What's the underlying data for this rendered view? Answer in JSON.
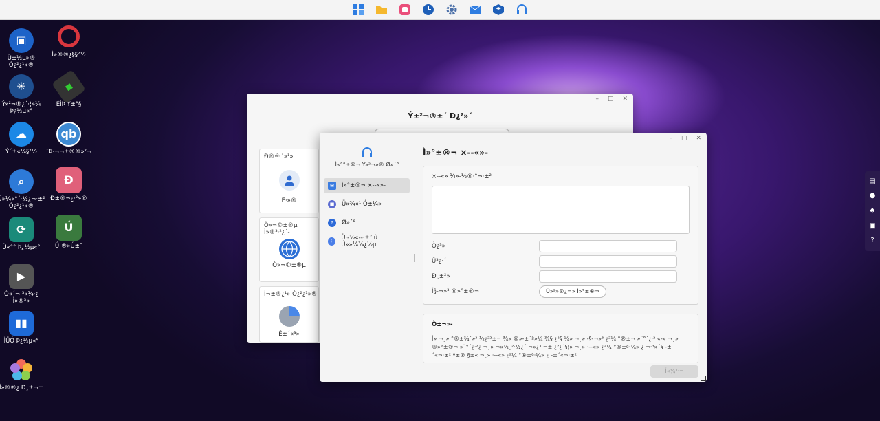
{
  "taskbar": {
    "icons": [
      "window-grid-icon",
      "folder-icon",
      "photo-gallery-icon",
      "clock-icon",
      "gear-icon",
      "mail-icon",
      "dev-cube-icon",
      "headset-icon"
    ]
  },
  "desktop": {
    "icons": [
      {
        "label": "Û±½µ»®\nÓ¿²¿¹»®",
        "icon": "docker-icon",
        "color": "#1d63c8"
      },
      {
        "label": "Ì»®®¿§§²½",
        "icon": "ring-icon",
        "color": "#d9363e"
      },
      {
        "label": "Ý»²¬®¿´·¦»¼\nÞ¿½µ«°",
        "icon": "network-icon",
        "color": "#1f4f8f"
      },
      {
        "label": "ÉÌÞ Ý±°§",
        "icon": "usb-copy-icon",
        "color": "#333333"
      },
      {
        "label": "Ý´±«¼§²½",
        "icon": "cloud-sync-icon",
        "color": "#1c88e6"
      },
      {
        "label": "¯Þ·¬¬±®®»²¬",
        "icon": "qbittorrent-icon",
        "color": "#3d8ad3"
      },
      {
        "label": "Ü»¼«°´·½¿¬·±²\nÓ¿²¿¹»®",
        "icon": "dedup-search-icon",
        "color": "#2d7ad8"
      },
      {
        "label": "Ð±®¬¿·²»®",
        "icon": "portainer-icon",
        "color": "#e0607a"
      },
      {
        "label": "Ü«°° Þ¿½µ«°",
        "icon": "sync-backup-icon",
        "color": "#1b8a7a"
      },
      {
        "label": "Ú·®»Ú±¨",
        "icon": "app-shortcut-icon",
        "color": "#3a7a3e"
      },
      {
        "label": "Ó«´¬·³»¼·¿\nÌ»®³»",
        "icon": "multimedia-icon",
        "color": "#555555"
      },
      {
        "label": "ÌÜÓ Þ¿½µ«°",
        "icon": "book-backup-icon",
        "color": "#1e6ad8"
      },
      {
        "label": "Ì»®®¿ Ð¸±¬±",
        "icon": "photos-flower-icon",
        "color": "#f0a030"
      }
    ]
  },
  "back_window": {
    "title": "Ý±²¬®±´ Ð¿²»´",
    "cards": [
      {
        "label": "Ð®·ª·´»¹»",
        "sub": "Ë·»®",
        "icon": "user-icon"
      },
      {
        "label": "Ò»¬©±®µ Ì»®³·²¿´-",
        "sub": "Ò»¬©±®µ",
        "icon": "globe-icon"
      },
      {
        "label": "Í¬±®¿¹» Ó¿²¿¹»®",
        "sub": "Ê±´«³»",
        "icon": "pie-chart-icon"
      }
    ]
  },
  "front_window": {
    "app_name": "Ì«°°±®¬ Ý»²¬»® Ø»´°",
    "nav": [
      {
        "label": "Ì»°±®¬ ×--«»-",
        "icon": "mail-report-icon",
        "color": "#3b7ce0"
      },
      {
        "label": "Ü»¾«¹ Ó±¼»",
        "icon": "lock-icon",
        "color": "#5b6bd0"
      },
      {
        "label": "Ø»´°",
        "icon": "help-icon",
        "color": "#2d6ad8"
      },
      {
        "label": "Ü·-½«--·±² û Ú»»¼¾¿½µ",
        "icon": "community-icon",
        "color": "#4a7ee8"
      }
    ],
    "heading": "Ì»°±®¬ ×--«»-",
    "form": {
      "description_label": "×--«» ¼»-½®·°¬·±²",
      "name_label": "Ò¿³»",
      "email_label": "Û³¿·´",
      "phone_label": "Ð¸±²»",
      "attach_label": "Í§-¬»³ ®»°±®¬",
      "attach_button": "Ù»²»®¿¬» Ì»°±®¬"
    },
    "note": {
      "title": "Ò±¬»-",
      "text": "Í» ¬¸» °®±¾´»³ ½¿²²±¬ ¾» ®»-±´ª»¼ ¾§ ¿²§ ¼» ¬¸» -§-¬»³ ¿²¼ °®±¬ »¨°´¿·² «-» ¬¸» ®»°±®¬ »¨°´¿·²¿ ¬¸» ¬»½¸²·½¿´ ¬»¿³ ¬± ¿²¿´§¦» ¬¸» ·--«» ¿²¼ °®±ª·¼» ¿ ¬·³»´§ -±´«¬·±² º±® §±« ¬¸» ·--«» ¿²¼ °®±ª·¼» ¿ -±´«¬·±²",
      "submit": "Í«¾³·¬"
    }
  },
  "right_rail": {
    "icons": [
      "info-panel-icon",
      "chat-icon",
      "bell-icon",
      "printer-icon",
      "help-circle-icon"
    ]
  }
}
